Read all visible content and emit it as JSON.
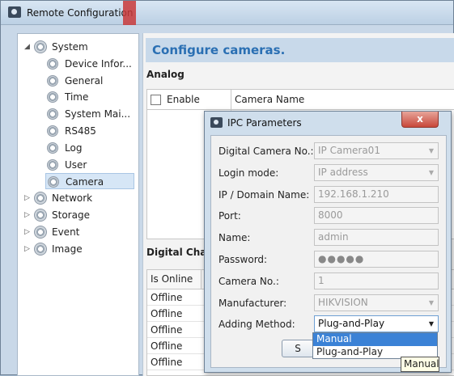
{
  "window": {
    "title": "Remote Configuration"
  },
  "tree": {
    "items": [
      {
        "label": "System",
        "level": 0,
        "expanded": true
      },
      {
        "label": "Device Infor...",
        "level": 1
      },
      {
        "label": "General",
        "level": 1
      },
      {
        "label": "Time",
        "level": 1
      },
      {
        "label": "System Mai...",
        "level": 1
      },
      {
        "label": "RS485",
        "level": 1
      },
      {
        "label": "Log",
        "level": 1
      },
      {
        "label": "User",
        "level": 1
      },
      {
        "label": "Camera",
        "level": 1,
        "selected": true
      },
      {
        "label": "Network",
        "level": 0,
        "expanded": false
      },
      {
        "label": "Storage",
        "level": 0,
        "expanded": false
      },
      {
        "label": "Event",
        "level": 0,
        "expanded": false
      },
      {
        "label": "Image",
        "level": 0,
        "expanded": false
      }
    ]
  },
  "main": {
    "title": "Configure cameras.",
    "analog_label": "Analog",
    "analog_columns": [
      "Enable",
      "Camera Name"
    ],
    "digital_label": "Digital Chann",
    "digital_columns": [
      "Is Online"
    ],
    "digital_rows": [
      "Offline",
      "Offline",
      "Offline",
      "Offline",
      "Offline"
    ]
  },
  "dialog": {
    "title": "IPC Parameters",
    "close_label": "x",
    "fields": [
      {
        "label": "Digital Camera No.:",
        "value": "IP Camera01",
        "dropdown": true
      },
      {
        "label": "Login mode:",
        "value": "IP address",
        "dropdown": true
      },
      {
        "label": "IP / Domain Name:",
        "value": "192.168.1.210"
      },
      {
        "label": "Port:",
        "value": "8000"
      },
      {
        "label": "Name:",
        "value": "admin"
      },
      {
        "label": "Password:",
        "value": "●●●●●"
      },
      {
        "label": "Camera No.:",
        "value": "1"
      },
      {
        "label": "Manufacturer:",
        "value": "HIKVISION",
        "dropdown": true
      },
      {
        "label": "Adding Method:",
        "value": "Plug-and-Play",
        "dropdown": true,
        "active": true
      }
    ],
    "dropdown_options": [
      "Manual",
      "Plug-and-Play"
    ],
    "ok_label": "S",
    "tooltip": "Manual"
  },
  "colors": {
    "accent": "#2a6fb3",
    "selection": "#3b82d6",
    "close": "#c8473a"
  }
}
